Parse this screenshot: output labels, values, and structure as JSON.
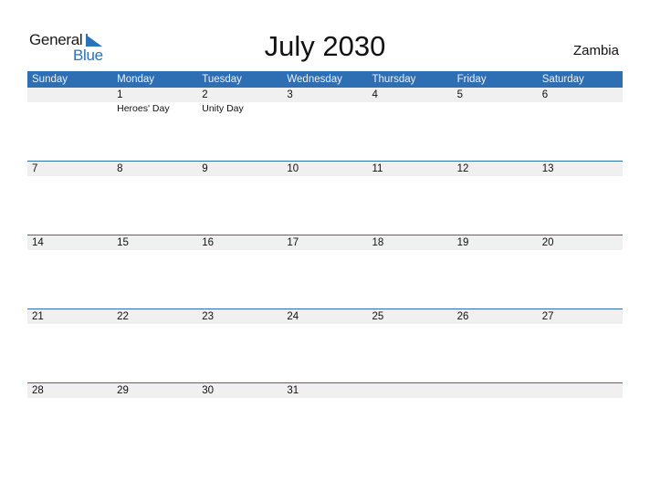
{
  "logo": {
    "word1": "General",
    "word2": "Blue",
    "accent": "#2b72b8"
  },
  "title": "July 2030",
  "country": "Zambia",
  "weekdays": [
    "Sunday",
    "Monday",
    "Tuesday",
    "Wednesday",
    "Thursday",
    "Friday",
    "Saturday"
  ],
  "colors": {
    "header_bg": "#2e6fb3",
    "day_band": "#f0f0f0"
  },
  "weeks": [
    [
      {
        "day": ""
      },
      {
        "day": "1",
        "holiday": "Heroes' Day"
      },
      {
        "day": "2",
        "holiday": "Unity Day"
      },
      {
        "day": "3"
      },
      {
        "day": "4"
      },
      {
        "day": "5"
      },
      {
        "day": "6"
      }
    ],
    [
      {
        "day": "7"
      },
      {
        "day": "8"
      },
      {
        "day": "9"
      },
      {
        "day": "10"
      },
      {
        "day": "11"
      },
      {
        "day": "12"
      },
      {
        "day": "13"
      }
    ],
    [
      {
        "day": "14"
      },
      {
        "day": "15"
      },
      {
        "day": "16"
      },
      {
        "day": "17"
      },
      {
        "day": "18"
      },
      {
        "day": "19"
      },
      {
        "day": "20"
      }
    ],
    [
      {
        "day": "21"
      },
      {
        "day": "22"
      },
      {
        "day": "23"
      },
      {
        "day": "24"
      },
      {
        "day": "25"
      },
      {
        "day": "26"
      },
      {
        "day": "27"
      }
    ],
    [
      {
        "day": "28"
      },
      {
        "day": "29"
      },
      {
        "day": "30"
      },
      {
        "day": "31"
      },
      {
        "day": ""
      },
      {
        "day": ""
      },
      {
        "day": ""
      }
    ]
  ]
}
